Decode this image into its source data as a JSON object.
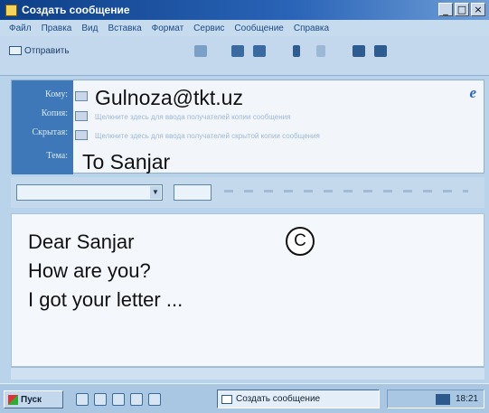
{
  "window": {
    "title": "Создать сообщение",
    "controls": [
      "_",
      "□",
      "×"
    ]
  },
  "menu": [
    "Файл",
    "Правка",
    "Вид",
    "Вставка",
    "Формат",
    "Сервис",
    "Сообщение",
    "Справка"
  ],
  "toolbar": {
    "send_label": "Отправить"
  },
  "header": {
    "to_label": "Кому:",
    "to_value": "Gulnoza@tkt.uz",
    "cc_label": "Копия:",
    "cc_hint": "Щелкните здесь для ввода получателей копии сообщения",
    "bcc_label": "Скрытая:",
    "bcc_hint": "Щелкните здесь для ввода получателей скрытой копии сообщения",
    "subject_label": "Тема:",
    "subject_value": "To Sanjar"
  },
  "body": {
    "lines": [
      "Dear Sanjar",
      "How are you?",
      "I got your letter ..."
    ]
  },
  "annotation_label": "C",
  "taskbar": {
    "start_label": "Пуск",
    "task_label": "Создать сообщение",
    "clock": "18:21"
  },
  "colors": {
    "titlebar": "#0d3f86",
    "label_column": "#3f78b8",
    "window_bg": "#b9d3ea"
  }
}
